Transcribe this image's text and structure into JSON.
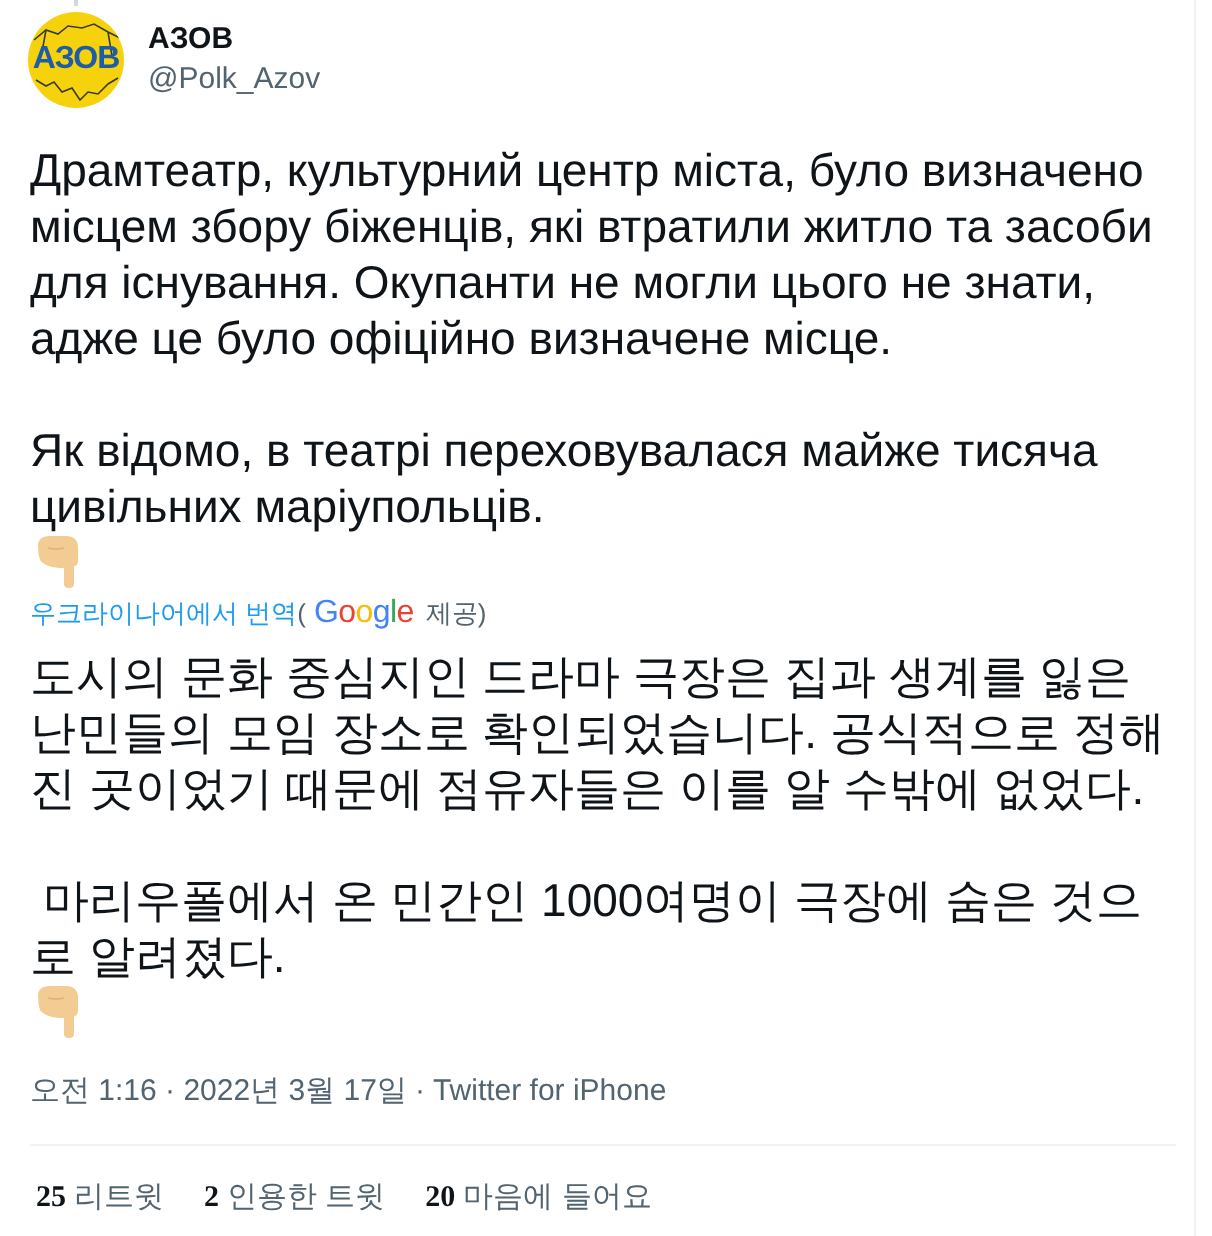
{
  "tweet": {
    "in_thread": true,
    "avatar": {
      "logo_text": "АЗОВ"
    },
    "author": {
      "name": "АЗОВ",
      "handle": "@Polk_Azov"
    },
    "body": [
      {
        "kind": "paragraph",
        "text": "Драмтеатр, культурний центр міста, було визначено місцем збору біженців, які втратили житло та засоби для існування. Окупанти не могли цього не знати, адже це було офіційно визначене місце."
      },
      {
        "kind": "paragraph",
        "text": "Як відомо, в театрі переховувалася майже тисяча цивільних маріупольців."
      },
      {
        "kind": "emoji"
      }
    ],
    "translation": {
      "link": "우크라이나어에서 번역",
      "open": "(",
      "provider_logo": "Google",
      "attribution": "제공)"
    },
    "translated_body": [
      {
        "kind": "paragraph",
        "text": "도시의 문화 중심지인 드라마 극장은 집과 생계를 잃은 난민들의 모임 장소로 확인되었습니다. 공식적으로 정해진 곳이었기 때문에 점유자들은 이를 알 수밖에 없었다."
      },
      {
        "kind": "paragraph",
        "text": " 마리우폴에서 온 민간인 1000여명이 극장에 숨은 것으로 알려졌다."
      },
      {
        "kind": "emoji"
      }
    ],
    "timestamp": "오전 1:16 · 2022년 3월 17일",
    "separator": "·",
    "source": "Twitter for iPhone",
    "stats": [
      {
        "count": "25",
        "label": "리트윗"
      },
      {
        "count": "2",
        "label": "인용한 트윗"
      },
      {
        "count": "20",
        "label": "마음에 들어요"
      }
    ]
  }
}
